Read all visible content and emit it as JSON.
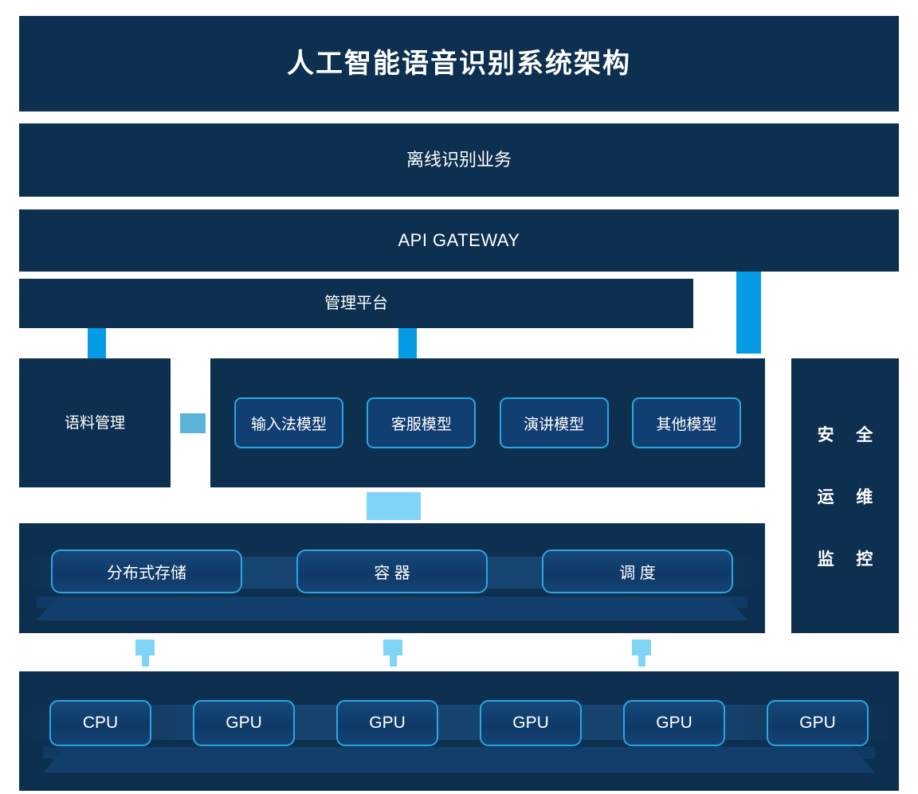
{
  "title": "人工智能语音识别系统架构",
  "layers": {
    "offline_service": "离线识别业务",
    "api_gateway": "API GATEWAY",
    "management_platform": "管理平台",
    "corpus_management": "语料管理"
  },
  "models": [
    {
      "label": "输入法模型"
    },
    {
      "label": "客服模型"
    },
    {
      "label": "演讲模型"
    },
    {
      "label": "其他模型"
    }
  ],
  "security_column": {
    "lines": [
      "安 全",
      "运 维",
      "监 控"
    ]
  },
  "infrastructure": [
    {
      "label": "分布式存储"
    },
    {
      "label": "容 器"
    },
    {
      "label": "调 度"
    }
  ],
  "hardware": [
    {
      "label": "CPU"
    },
    {
      "label": "GPU"
    },
    {
      "label": "GPU"
    },
    {
      "label": "GPU"
    },
    {
      "label": "GPU"
    },
    {
      "label": "GPU"
    }
  ],
  "colors": {
    "panel_navy": "#0e3050",
    "box_fill": "#123f72",
    "accent_border": "#2aa6e0",
    "connector_bright": "#059be5",
    "connector_muted": "#5bb3d8",
    "connector_light": "#7fd4f7",
    "text": "#ffffff",
    "page_background": "#ffffff"
  }
}
